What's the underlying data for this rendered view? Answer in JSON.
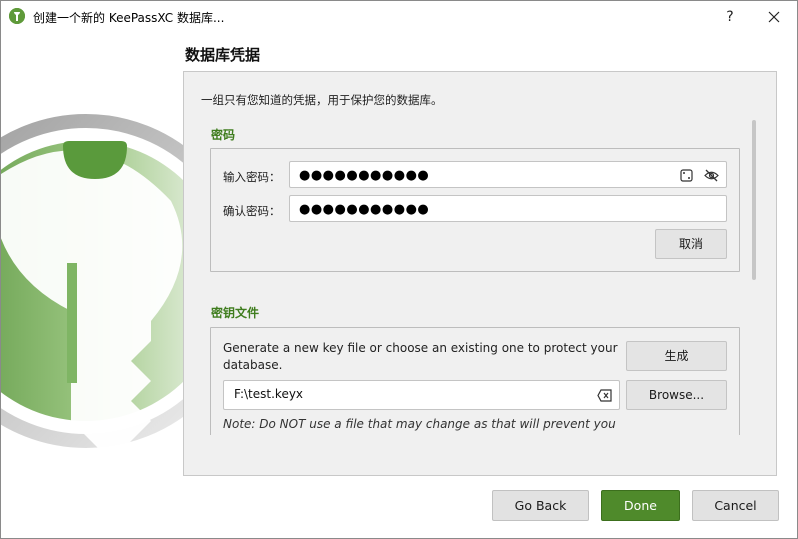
{
  "window": {
    "title": "创建一个新的 KeePassXC 数据库...",
    "help_label": "?",
    "close_icon": "close-icon"
  },
  "page": {
    "title": "数据库凭据",
    "description": "一组只有您知道的凭据，用于保护您的数据库。"
  },
  "password_section": {
    "title": "密码",
    "enter_label": "输入密码：",
    "enter_value": "●●●●●●●●●●●",
    "confirm_label": "确认密码：",
    "confirm_value": "●●●●●●●●●●●",
    "generate_icon": "dice-icon",
    "toggle_visibility_icon": "eye-slash-icon",
    "cancel_label": "取消"
  },
  "keyfile_section": {
    "title": "密钥文件",
    "description": "Generate a new key file or choose an existing one to protect your database.",
    "generate_label": "生成",
    "path_value": "F:\\test.keyx",
    "clear_icon": "clear-input-icon",
    "browse_label": "Browse...",
    "note": "Note: Do NOT use a file that may change as that will prevent you"
  },
  "footer": {
    "back_label": "Go Back",
    "done_label": "Done",
    "cancel_label": "Cancel"
  },
  "colors": {
    "accent": "#4f8a2b",
    "section_title": "#3f7d1e"
  }
}
